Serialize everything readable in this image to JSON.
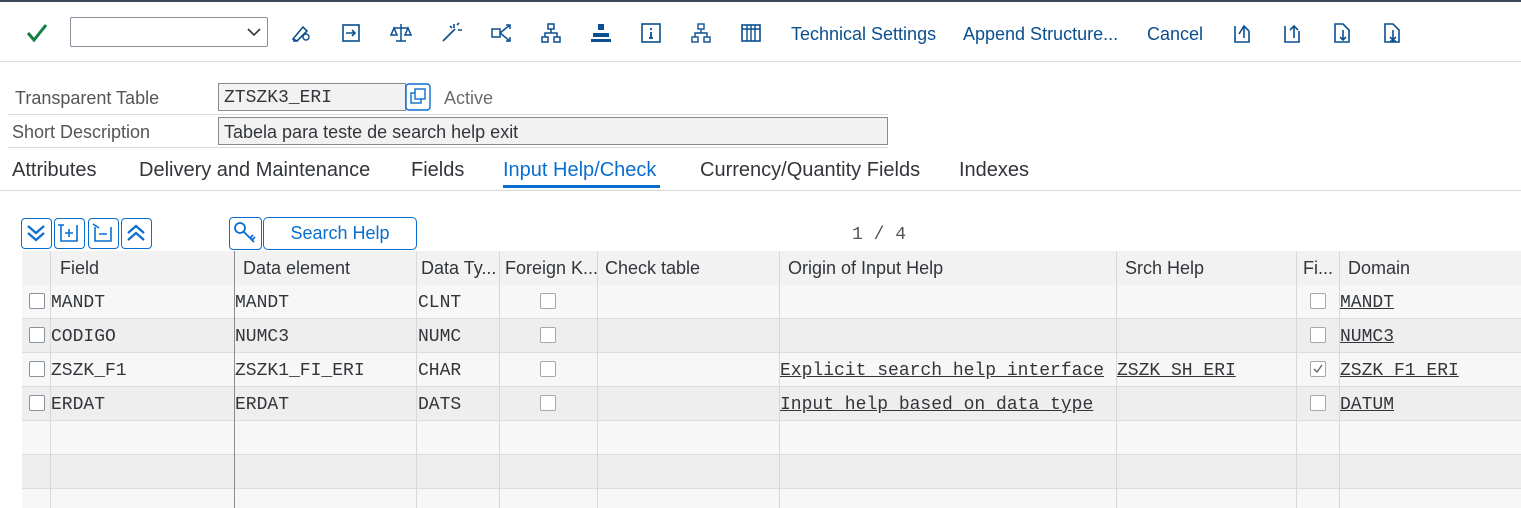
{
  "toolbar": {
    "buttons": [
      "Technical Settings",
      "Append Structure...",
      "Cancel"
    ],
    "combo_value": ""
  },
  "header": {
    "table_type_label": "Transparent Table",
    "table_name": "ZTSZK3_ERI",
    "status": "Active",
    "short_desc_label": "Short Description",
    "short_desc": "Tabela para teste de search help exit"
  },
  "tabs": [
    "Attributes",
    "Delivery and Maintenance",
    "Fields",
    "Input Help/Check",
    "Currency/Quantity Fields",
    "Indexes"
  ],
  "active_tab": "Input Help/Check",
  "grid_toolbar": {
    "search_help_label": "Search Help",
    "pager": "1 / 4"
  },
  "columns": [
    "Field",
    "Data element",
    "Data Ty...",
    "Foreign K...",
    "Check table",
    "Origin of Input Help",
    "Srch Help",
    "Fi...",
    "Domain"
  ],
  "rows": [
    {
      "field": "MANDT",
      "data_element": "MANDT",
      "data_type": "CLNT",
      "check_table": "",
      "origin": "",
      "srch_help": "",
      "fixed_checked": false,
      "domain": "MANDT"
    },
    {
      "field": "CODIGO",
      "data_element": "NUMC3",
      "data_type": "NUMC",
      "check_table": "",
      "origin": "",
      "srch_help": "",
      "fixed_checked": false,
      "domain": "NUMC3"
    },
    {
      "field": "ZSZK_F1",
      "data_element": "ZSZK1_FI_ERI",
      "data_type": "CHAR",
      "check_table": "",
      "origin": "Explicit search help interface",
      "srch_help": "ZSZK_SH_ERI",
      "fixed_checked": true,
      "domain": "ZSZK_F1_ERI"
    },
    {
      "field": "ERDAT",
      "data_element": "ERDAT",
      "data_type": "DATS",
      "check_table": "",
      "origin": "Input help based on data type",
      "srch_help": "",
      "fixed_checked": false,
      "domain": "DATUM"
    }
  ],
  "colors": {
    "accent": "#0a6ed1",
    "ok_green": "#107e3e"
  }
}
